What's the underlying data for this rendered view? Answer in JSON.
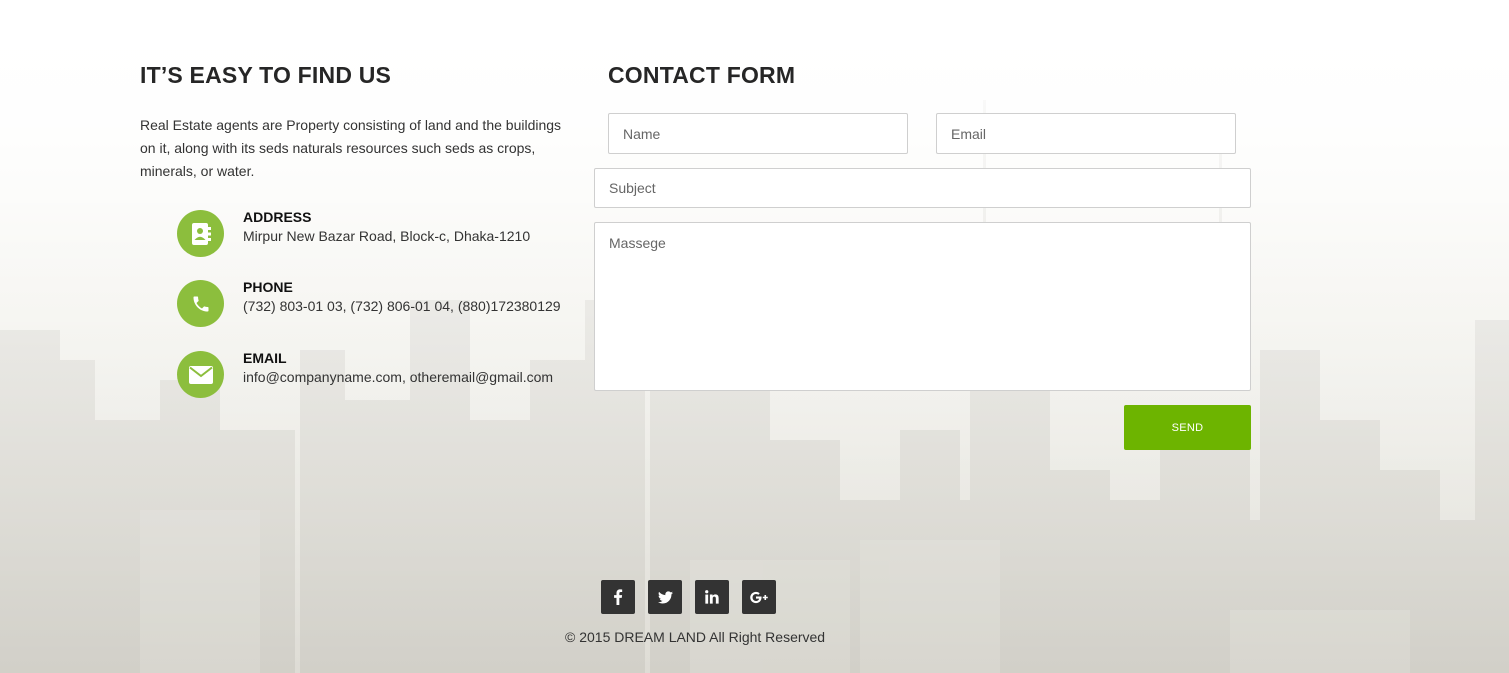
{
  "left": {
    "title": "IT’S EASY TO FIND US",
    "intro": "Real Estate agents are Property consisting of land and the buildings on it, along with its seds naturals resources such seds as crops, minerals, or water.",
    "items": [
      {
        "icon": "address-book-icon",
        "label": "ADDRESS",
        "value": "Mirpur New Bazar Road, Block-c, Dhaka-1210"
      },
      {
        "icon": "phone-icon",
        "label": "PHONE",
        "value": "(732) 803-01 03, (732) 806-01 04, (880)172380129"
      },
      {
        "icon": "envelope-icon",
        "label": "EMAIL",
        "value": "info@companyname.com, otheremail@gmail.com"
      }
    ]
  },
  "form": {
    "title": "CONTACT FORM",
    "name_placeholder": "Name",
    "email_placeholder": "Email",
    "subject_placeholder": "Subject",
    "message_placeholder": "Massege",
    "send_label": "SEND"
  },
  "footer": {
    "social": [
      "facebook-icon",
      "twitter-icon",
      "linkedin-icon",
      "google-plus-icon"
    ],
    "copyright": "© 2015 DREAM LAND All Right Reserved"
  },
  "colors": {
    "accent_icon": "#8cbe3d",
    "send_button": "#6db400",
    "social_bg": "#333333"
  }
}
